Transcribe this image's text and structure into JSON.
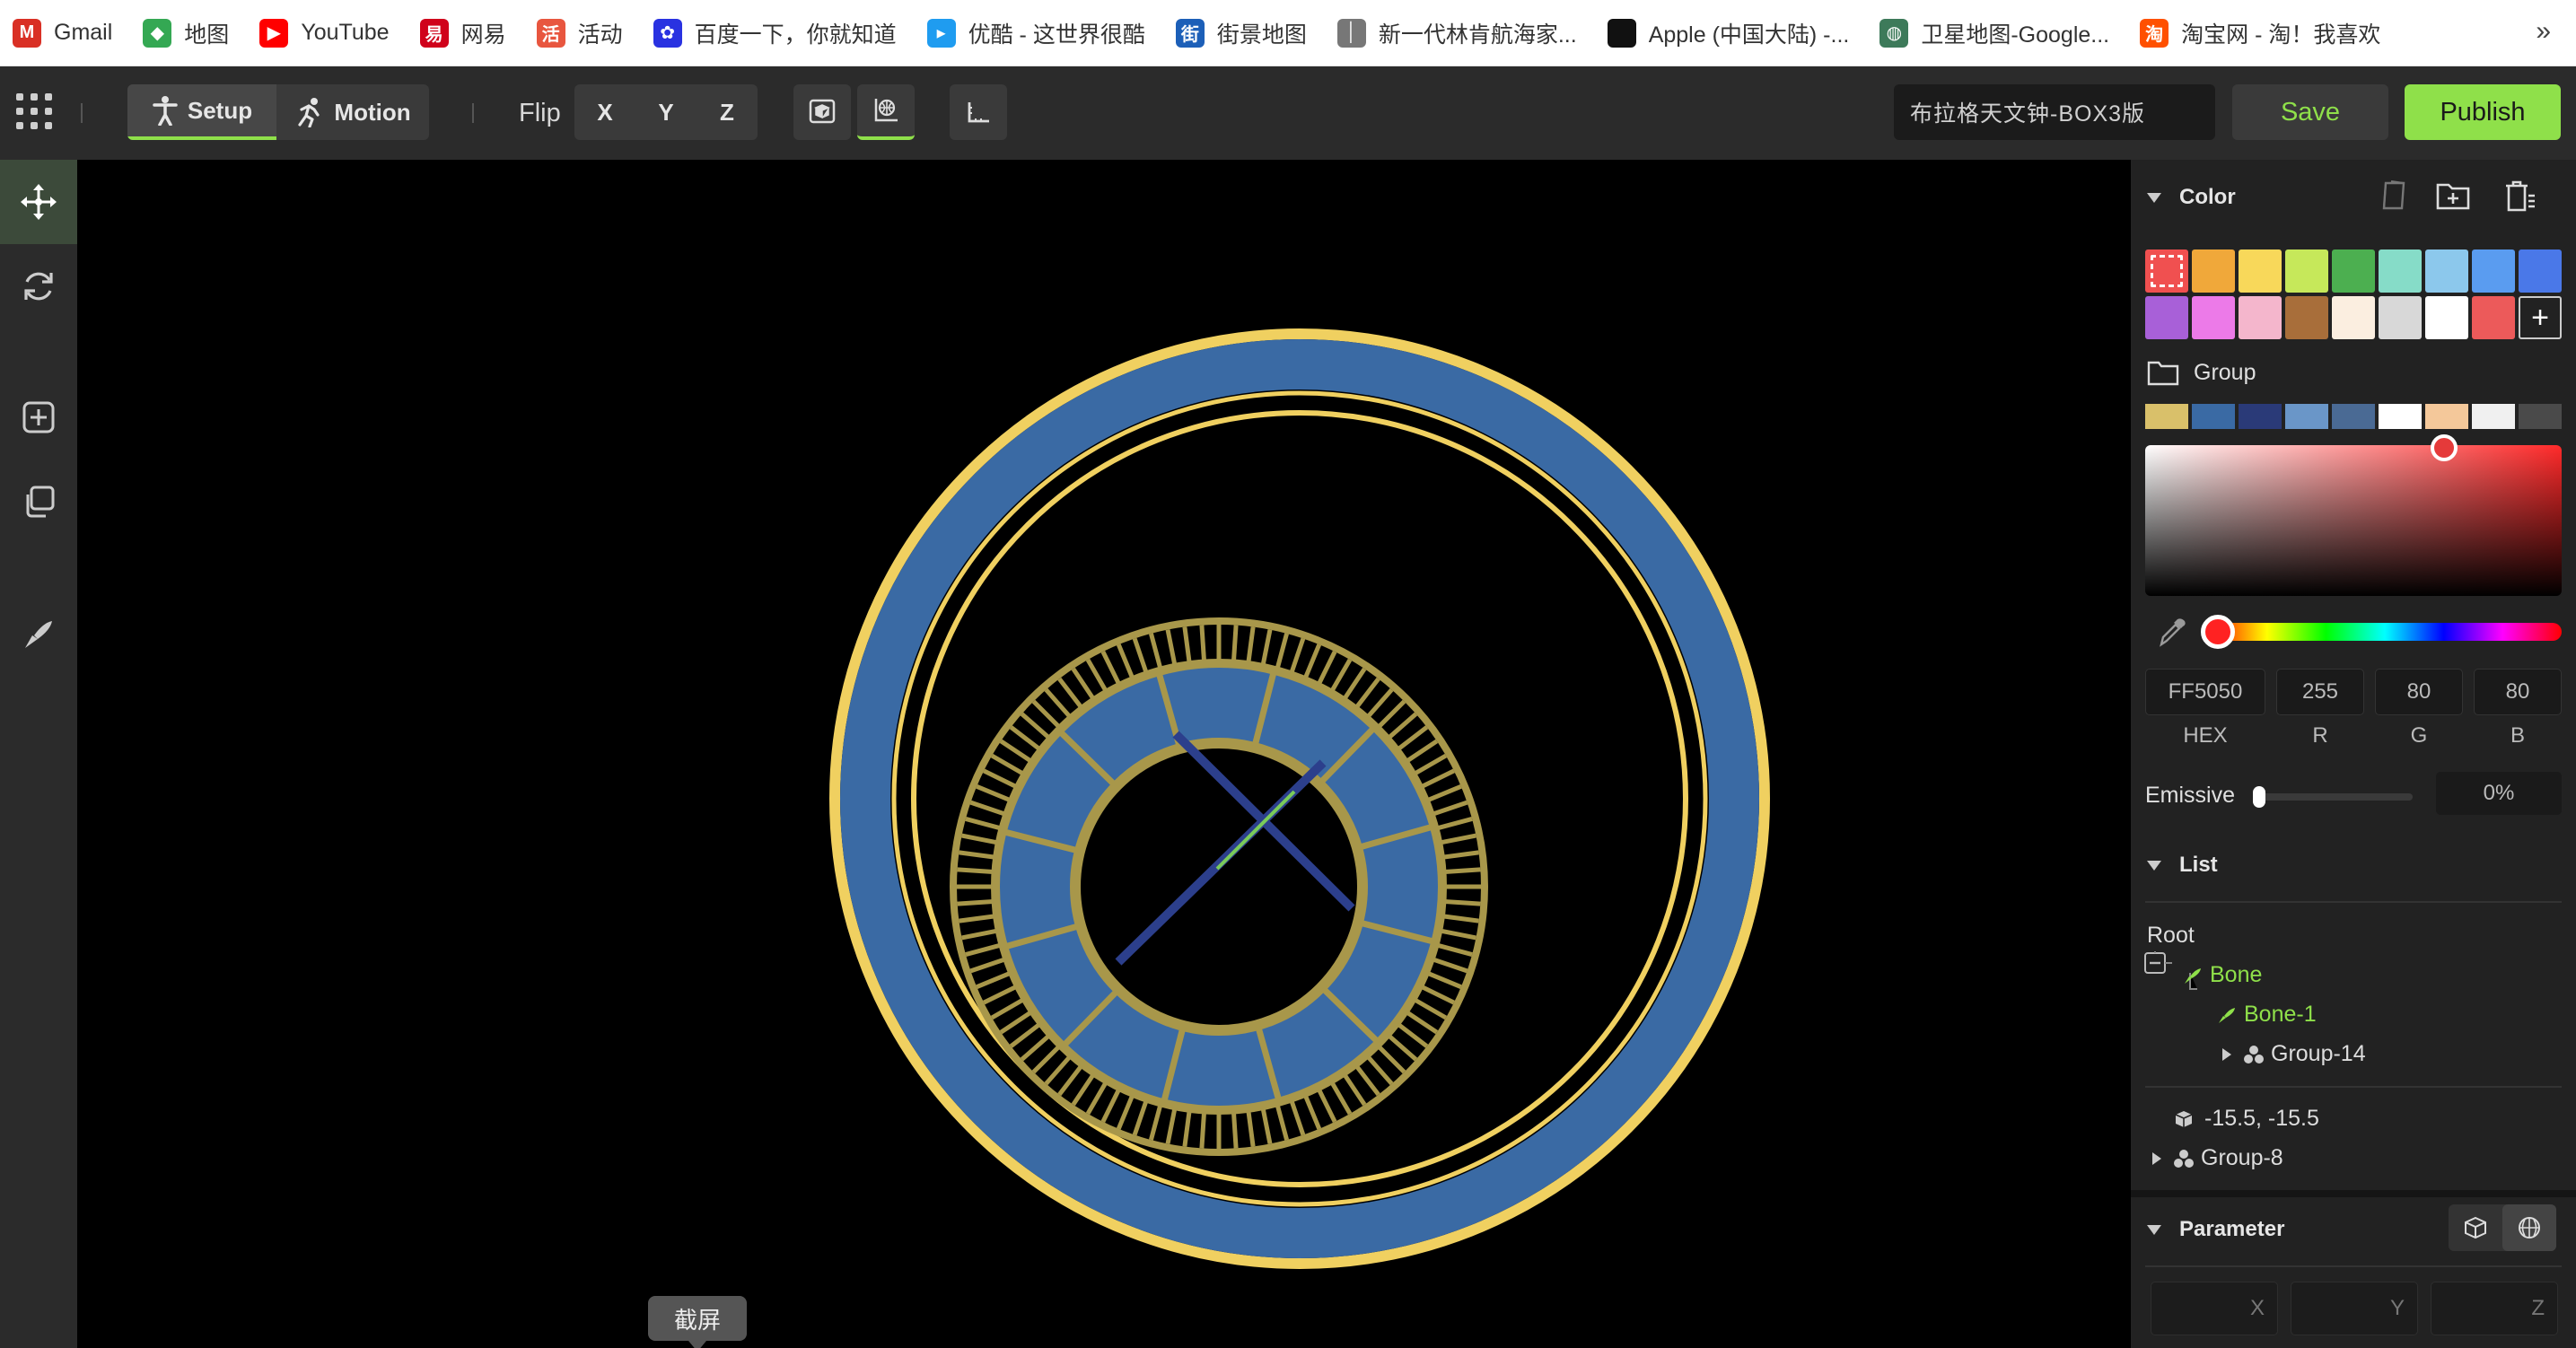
{
  "bookmarks": [
    {
      "label": "Gmail",
      "icon": "gmail-icon",
      "color": "#d93025",
      "glyph": "M"
    },
    {
      "label": "地图",
      "icon": "maps-icon",
      "color": "#34a853",
      "glyph": "◆"
    },
    {
      "label": "YouTube",
      "icon": "youtube-icon",
      "color": "#ff0000",
      "glyph": "▶"
    },
    {
      "label": "网易",
      "icon": "netease-icon",
      "color": "#d0021b",
      "glyph": "易"
    },
    {
      "label": "活动",
      "icon": "activity-icon",
      "color": "#e8563f",
      "glyph": "活"
    },
    {
      "label": "百度一下，你就知道",
      "icon": "baidu-icon",
      "color": "#2932e1",
      "glyph": "✿"
    },
    {
      "label": "优酷 - 这世界很酷",
      "icon": "youku-icon",
      "color": "#1f9cf0",
      "glyph": "▸"
    },
    {
      "label": "街景地图",
      "icon": "streetview-icon",
      "color": "#1c5fb8",
      "glyph": "街"
    },
    {
      "label": "新一代林肯航海家...",
      "icon": "lincoln-icon",
      "color": "#777777",
      "glyph": "│"
    },
    {
      "label": "Apple (中国大陆) -...",
      "icon": "apple-icon",
      "color": "#111111",
      "glyph": ""
    },
    {
      "label": "卫星地图-Google...",
      "icon": "globe-icon",
      "color": "#3d7a5a",
      "glyph": "◍"
    },
    {
      "label": "淘宝网 - 淘！我喜欢",
      "icon": "taobao-icon",
      "color": "#ff5000",
      "glyph": "淘"
    }
  ],
  "bookmarks_more": "»",
  "toolbar": {
    "setup_label": "Setup",
    "motion_label": "Motion",
    "flip_label": "Flip",
    "flip_axes": [
      "X",
      "Y",
      "Z"
    ],
    "project_name": "布拉格天文钟-BOX3版",
    "save_label": "Save",
    "publish_label": "Publish",
    "accent": "#8fe04a"
  },
  "viewport": {
    "tooltip": "截屏",
    "clock_colors": {
      "gold": "#f0d060",
      "dark_gold": "#a8974a",
      "blue": "#3a6aa4",
      "hand": "#2c3f8c",
      "hand_green": "#7acb5a"
    }
  },
  "color_panel": {
    "title": "Color",
    "palette": [
      "#f05050",
      "#f0a83a",
      "#f8d85a",
      "#c6e85a",
      "#4caf50",
      "#86dcc8",
      "#8cc8ec",
      "#5a9cf0",
      "#4a78e8",
      "#a860d8",
      "#ec7ae8",
      "#f4b6cc",
      "#a86e3a",
      "#fbeee0",
      "#d8d8d8",
      "#ffffff",
      "#ec5a5a"
    ],
    "selected_index": 0,
    "add_label": "+",
    "group_label": "Group",
    "group_colors": [
      "#d9c06a",
      "#3a6aa4",
      "#2a3a78",
      "#6a96c8",
      "#4a6a94",
      "#ffffff",
      "#f4c89a",
      "#f0f0f0",
      "#4a4a4a"
    ],
    "hex_value": "FF5050",
    "r_value": "255",
    "g_value": "80",
    "b_value": "80",
    "hex_label": "HEX",
    "r_label": "R",
    "g_label": "G",
    "b_label": "B",
    "emissive_label": "Emissive",
    "emissive_value": "0%",
    "emissive_level": 0
  },
  "list_panel": {
    "title": "List",
    "root_label": "Root",
    "bone_label": "Bone",
    "bone1_label": "Bone-1",
    "group14_label": "Group-14",
    "coords_label": "-15.5,  -15.5",
    "group8_label": "Group-8"
  },
  "parameter_panel": {
    "title": "Parameter",
    "x_label": "X",
    "y_label": "Y",
    "z_label": "Z"
  }
}
